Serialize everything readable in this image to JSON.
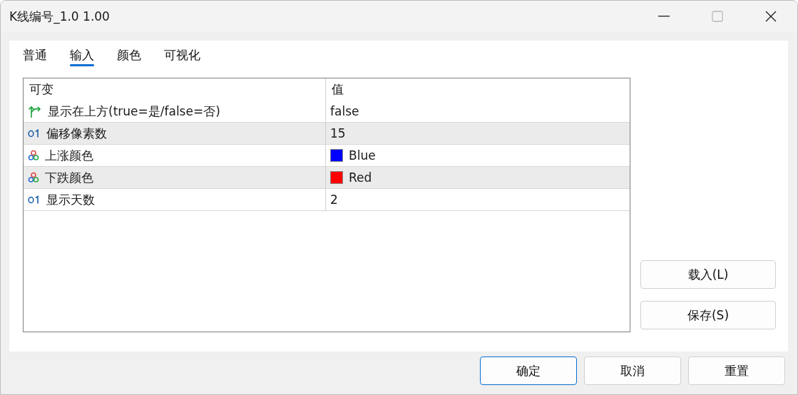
{
  "window": {
    "title": "K线编号_1.0 1.00"
  },
  "tabs": [
    {
      "label": "普通",
      "selected": false
    },
    {
      "label": "输入",
      "selected": true
    },
    {
      "label": "颜色",
      "selected": false
    },
    {
      "label": "可视化",
      "selected": false
    }
  ],
  "table": {
    "columns": [
      "可变",
      "值"
    ],
    "rows": [
      {
        "kind": "bool",
        "name": "显示在上方(true=是/false=否)",
        "value": "false"
      },
      {
        "kind": "int",
        "name": "偏移像素数",
        "value": "15"
      },
      {
        "kind": "color",
        "name": "上涨颜色",
        "value": "Blue",
        "color": "#0000ff"
      },
      {
        "kind": "color",
        "name": "下跌颜色",
        "value": "Red",
        "color": "#ff0000"
      },
      {
        "kind": "int",
        "name": "显示天数",
        "value": "2"
      }
    ]
  },
  "side_buttons": [
    "载入(L)",
    "保存(S)"
  ],
  "buttons": [
    {
      "label": "确定",
      "default": true
    },
    {
      "label": "取消",
      "default": false
    },
    {
      "label": "重置",
      "default": false
    }
  ]
}
